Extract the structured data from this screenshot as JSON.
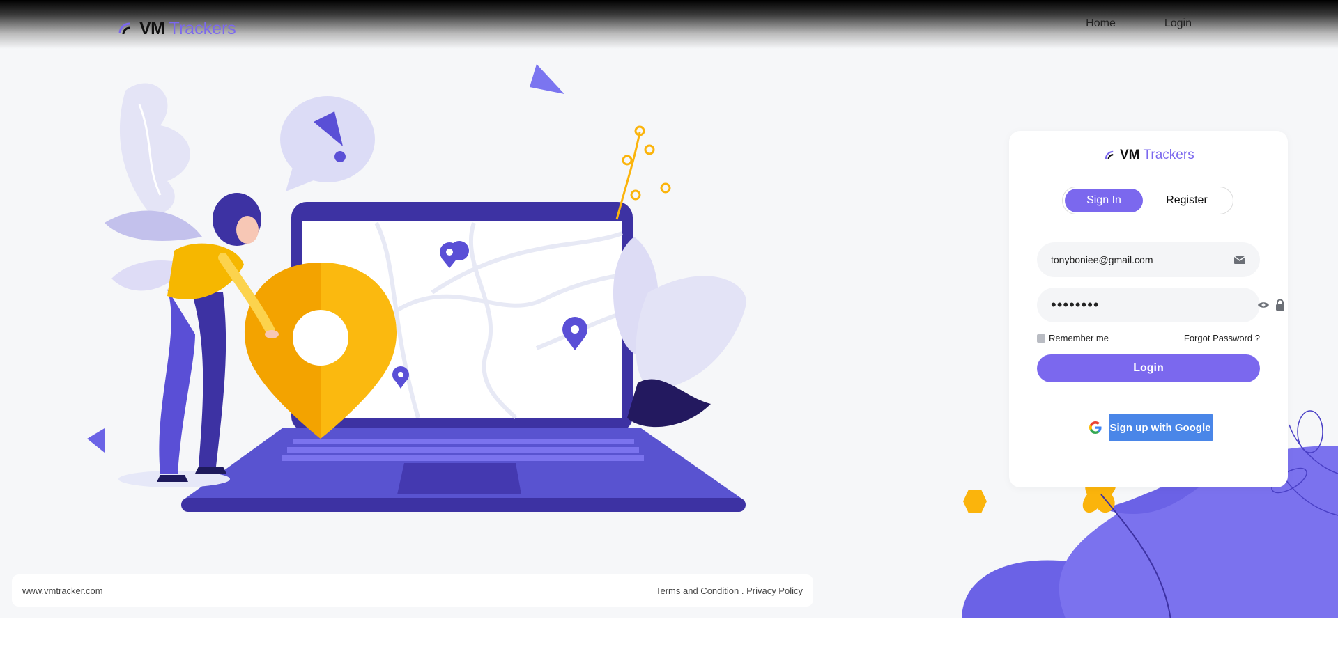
{
  "brand": {
    "name_bold": "VM",
    "name_accent": "Trackers"
  },
  "nav": {
    "home": "Home",
    "login": "Login"
  },
  "card": {
    "brand_bold": "VM",
    "brand_accent": "Trackers",
    "tabs": [
      {
        "label": "Sign In",
        "active": true
      },
      {
        "label": "Register",
        "active": false
      }
    ],
    "email": {
      "value": "tonyboniee@gmail.com"
    },
    "password": {
      "value": "••••••••"
    },
    "remember_label": "Remember me",
    "forgot_label": "Forgot Password ?",
    "login_button": "Login",
    "google_button": "Sign up with Google"
  },
  "footer": {
    "site": "www.vmtracker.com",
    "terms": "Terms and Condition",
    "separator": " . ",
    "privacy": "Privacy Policy"
  },
  "colors": {
    "accent": "#7b68ee",
    "yellow": "#fbb40c",
    "navy": "#3b2f9e"
  }
}
